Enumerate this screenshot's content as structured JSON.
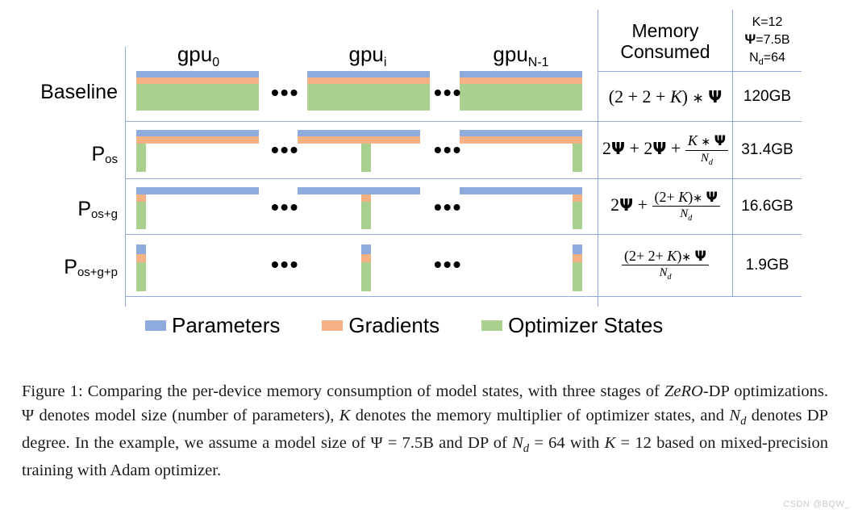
{
  "figure": {
    "gpu_headers": [
      {
        "base": "gpu",
        "sub": "0"
      },
      {
        "base": "gpu",
        "sub": "i"
      },
      {
        "base": "gpu",
        "sub": "N-1"
      }
    ],
    "ellipsis": "•••",
    "rows": [
      {
        "label": "Baseline",
        "sub": ""
      },
      {
        "label": "P",
        "sub": "os"
      },
      {
        "label": "P",
        "sub": "os+g"
      },
      {
        "label": "P",
        "sub": "os+g+p"
      }
    ],
    "table": {
      "header_memory": "Memory\nConsumed",
      "header_memory_line1": "Memory",
      "header_memory_line2": "Consumed",
      "header_params": [
        "K=12",
        "Ψ=7.5B",
        "Nₐ=64"
      ],
      "header_params_k": "K=12",
      "header_params_psi_label": "Ψ",
      "header_params_psi_value": "=7.5B",
      "header_params_nd_label": "N",
      "header_params_nd_sub": "d",
      "header_params_nd_value": "=64",
      "formulas": [
        "(2 + 2 + K) * Ψ",
        "2Ψ + 2Ψ + (K * Ψ)/N_d",
        "2Ψ + ((2+ K)* Ψ)/N_d",
        "((2+ 2+ K)* Ψ)/N_d"
      ],
      "values": [
        "120GB",
        "31.4GB",
        "16.6GB",
        "1.9GB"
      ]
    },
    "legend": [
      {
        "label": "Parameters",
        "color": "#8faadc"
      },
      {
        "label": "Gradients",
        "color": "#f4b183"
      },
      {
        "label": "Optimizer States",
        "color": "#a9d08e"
      }
    ],
    "colors": {
      "parameters": "#8faadc",
      "gradients": "#f4b183",
      "optimizer_states": "#a9d08e",
      "gridline": "#8faadc"
    }
  },
  "caption": {
    "prefix": "Figure 1:",
    "text": "Comparing the per-device memory consumption of model states, with three stages of ZeRO-DP optimizations. Ψ denotes model size (number of parameters), K denotes the memory multiplier of optimizer states, and N_d denotes DP degree. In the example, we assume a model size of Ψ = 7.5B and DP of N_d = 64 with K = 12 based on mixed-precision training with Adam optimizer.",
    "seg1": "Figure 1:",
    "seg2": " Comparing the per-device memory consumption of model states, with three stages of ",
    "seg3": "ZeRO",
    "seg4": "-DP optimizations. ",
    "seg5": "Ψ",
    "seg6": " denotes model size (number of parameters), ",
    "seg7": "K",
    "seg8": " denotes the memory multiplier of optimizer states, and ",
    "seg9": "N",
    "seg10": "d",
    "seg11": " denotes DP degree. In the example, we assume a model size of ",
    "seg12": "Ψ = 7.5B",
    "seg13": " and DP of ",
    "seg14": "N",
    "seg15": "d",
    "seg16": " = 64 with ",
    "seg17": "K",
    "seg18": " = 12 based on mixed-precision training with Adam optimizer."
  },
  "watermark": "CSDN @BQW_"
}
